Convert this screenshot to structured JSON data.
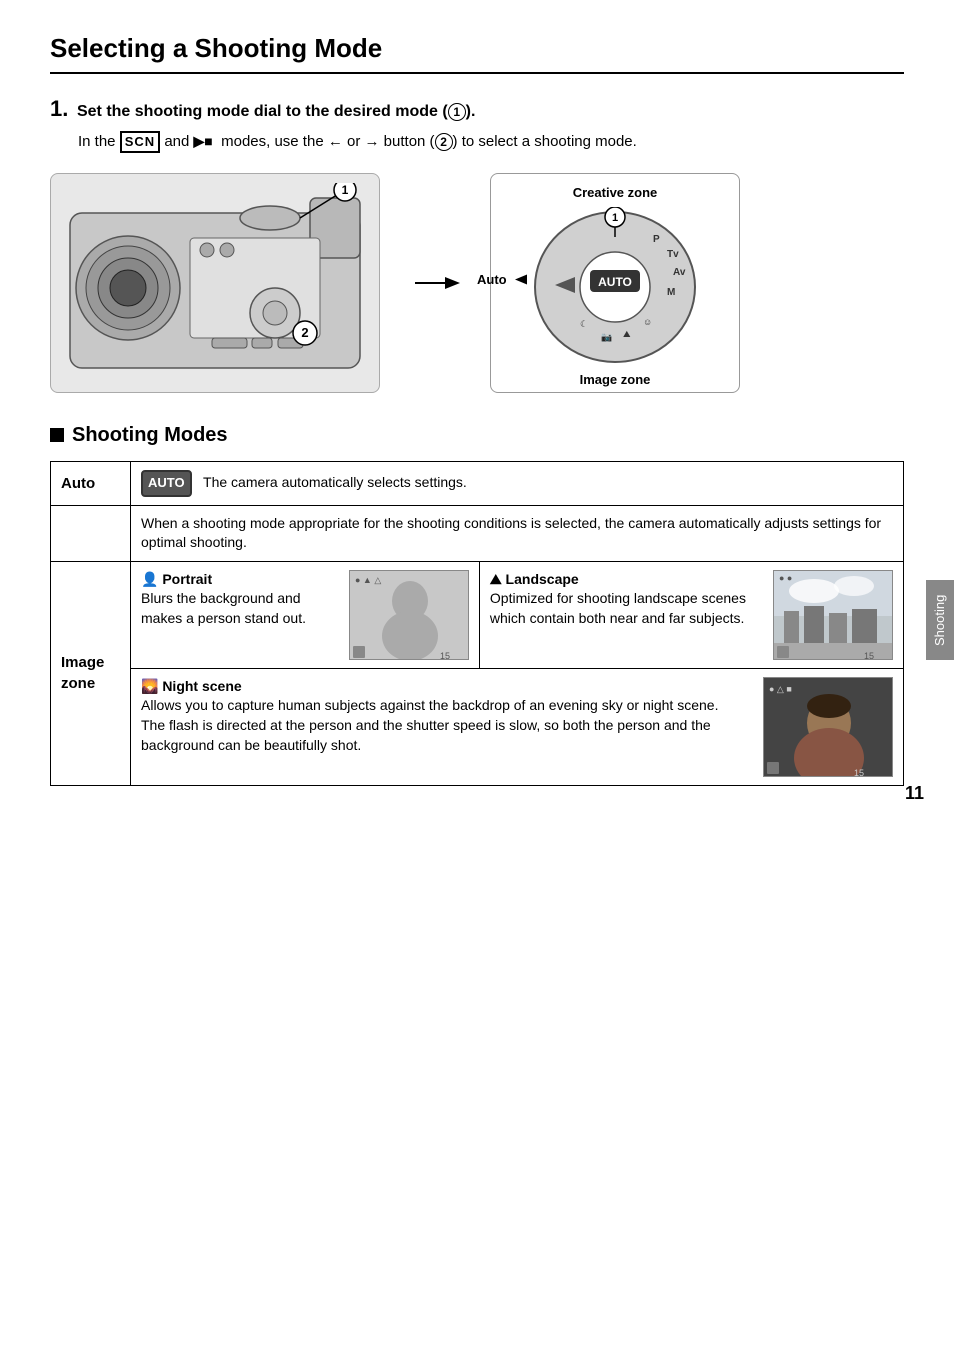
{
  "page": {
    "title": "Selecting a Shooting Mode",
    "number": "11",
    "side_tab": "Shooting"
  },
  "step1": {
    "label": "1.",
    "heading": "Set the shooting mode dial to the desired mode (①).",
    "description_pre": "In the",
    "scn": "SCN",
    "description_mid": "and",
    "movie_icon": "►■",
    "description_mid2": "modes, use the ← or → button (②) to select a shooting mode.",
    "callout1": "①",
    "callout2": "②"
  },
  "dial_zone": {
    "creative_label": "Creative zone",
    "auto_label": "Auto",
    "image_label": "Image zone",
    "auto_badge": "AUTO"
  },
  "section_shooting_modes": {
    "title": "Shooting Modes"
  },
  "table": {
    "rows": [
      {
        "label": "Auto",
        "col1_icon": "AUTO",
        "col1_text": "The camera automatically selects settings.",
        "type": "auto"
      },
      {
        "label": "",
        "col1_text": "When a shooting mode appropriate for the shooting conditions is selected, the camera automatically adjusts settings for optimal shooting.",
        "type": "description"
      },
      {
        "label": "Image zone",
        "type": "image_zone",
        "portrait_heading": "👤 Portrait",
        "portrait_icon": "☀",
        "portrait_text": "Blurs the background and makes a person stand out.",
        "landscape_heading": "⛰ Landscape",
        "landscape_text": "Optimized for shooting landscape scenes which contain both near and far subjects.",
        "night_heading": "🌄 Night scene",
        "night_text": "Allows you to capture human subjects against the backdrop of an evening sky or night scene. The flash is directed at the person and the shutter speed is slow, so both the person and the background can be beautifully shot."
      }
    ]
  }
}
